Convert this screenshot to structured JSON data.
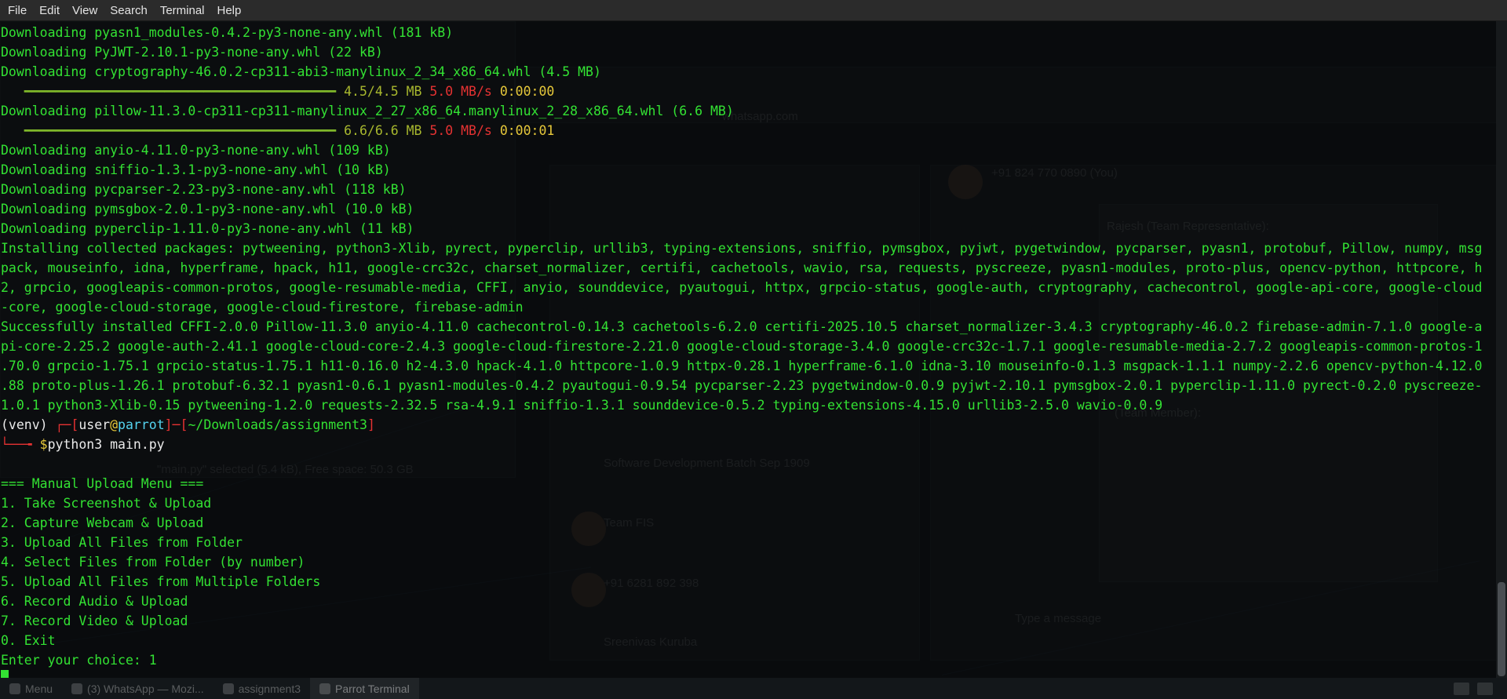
{
  "menubar": [
    "File",
    "Edit",
    "View",
    "Search",
    "Terminal",
    "Help"
  ],
  "colors": {
    "text": "#33e233",
    "progress": "#a8b82e",
    "speed": "#e63232",
    "eta": "#e6c83a",
    "prompt_red": "#e63232",
    "host_cyan": "#55d4f0"
  },
  "terminal": {
    "downloads_top": [
      "Downloading pyasn1_modules-0.4.2-py3-none-any.whl (181 kB)",
      "Downloading PyJWT-2.10.1-py3-none-any.whl (22 kB)",
      "Downloading cryptography-46.0.2-cp311-abi3-manylinux_2_34_x86_64.whl (4.5 MB)"
    ],
    "progress1": {
      "bar": "━━━━━━━━━━━━━━━━━━━━━━━━━━━━━━━━━━━━━━━━",
      "size": "4.5/4.5 MB",
      "speed": "5.0 MB/s",
      "eta": "0:00:00"
    },
    "download_pillow": "Downloading pillow-11.3.0-cp311-cp311-manylinux_2_27_x86_64.manylinux_2_28_x86_64.whl (6.6 MB)",
    "progress2": {
      "bar": "━━━━━━━━━━━━━━━━━━━━━━━━━━━━━━━━━━━━━━━━",
      "size": "6.6/6.6 MB",
      "speed": "5.0 MB/s",
      "eta": "0:00:01"
    },
    "downloads_bottom": [
      "Downloading anyio-4.11.0-py3-none-any.whl (109 kB)",
      "Downloading sniffio-1.3.1-py3-none-any.whl (10 kB)",
      "Downloading pycparser-2.23-py3-none-any.whl (118 kB)",
      "Downloading pymsgbox-2.0.1-py3-none-any.whl (10.0 kB)",
      "Downloading pyperclip-1.11.0-py3-none-any.whl (11 kB)"
    ],
    "installing": [
      "Installing collected packages: pytweening, python3-Xlib, pyrect, pyperclip, urllib3, typing-extensions, sniffio, pymsgbox, pyjwt, pygetwindow, pycparser, pyasn1, protobuf, Pillow, numpy, msg",
      "pack, mouseinfo, idna, hyperframe, hpack, h11, google-crc32c, charset_normalizer, certifi, cachetools, wavio, rsa, requests, pyscreeze, pyasn1-modules, proto-plus, opencv-python, httpcore, h",
      "2, grpcio, googleapis-common-protos, google-resumable-media, CFFI, anyio, sounddevice, pyautogui, httpx, grpcio-status, google-auth, cryptography, cachecontrol, google-api-core, google-cloud",
      "-core, google-cloud-storage, google-cloud-firestore, firebase-admin"
    ],
    "installed": [
      "Successfully installed CFFI-2.0.0 Pillow-11.3.0 anyio-4.11.0 cachecontrol-0.14.3 cachetools-6.2.0 certifi-2025.10.5 charset_normalizer-3.4.3 cryptography-46.0.2 firebase-admin-7.1.0 google-a",
      "pi-core-2.25.2 google-auth-2.41.1 google-cloud-core-2.4.3 google-cloud-firestore-2.21.0 google-cloud-storage-3.4.0 google-crc32c-1.7.1 google-resumable-media-2.7.2 googleapis-common-protos-1",
      ".70.0 grpcio-1.75.1 grpcio-status-1.75.1 h11-0.16.0 h2-4.3.0 hpack-4.1.0 httpcore-1.0.9 httpx-0.28.1 hyperframe-6.1.0 idna-3.10 mouseinfo-0.1.3 msgpack-1.1.1 numpy-2.2.6 opencv-python-4.12.0",
      ".88 proto-plus-1.26.1 protobuf-6.32.1 pyasn1-0.6.1 pyasn1-modules-0.4.2 pyautogui-0.9.54 pycparser-2.23 pygetwindow-0.0.9 pyjwt-2.10.1 pymsgbox-2.0.1 pyperclip-1.11.0 pyrect-0.2.0 pyscreeze-",
      "1.0.1 python3-Xlib-0.15 pytweening-1.2.0 requests-2.32.5 rsa-4.9.1 sniffio-1.3.1 sounddevice-0.5.2 typing-extensions-4.15.0 urllib3-2.5.0 wavio-0.0.9"
    ],
    "prompt": {
      "venv": "(venv) ",
      "corner_top": "┌─[",
      "user": "user",
      "at": "@",
      "host": "parrot",
      "mid": "]─[",
      "path": "~/Downloads/assignment3",
      "end": "]",
      "corner_bottom": "└──╼ ",
      "dollar": "$",
      "command": "python3 main.py"
    },
    "menu_lines": [
      "=== Manual Upload Menu ===",
      "1. Take Screenshot & Upload",
      "2. Capture Webcam & Upload",
      "3. Upload All Files from Folder",
      "4. Select Files from Folder (by number)",
      "5. Upload All Files from Multiple Folders",
      "6. Record Audio & Upload",
      "7. Record Video & Upload",
      "0. Exit"
    ],
    "choice_prompt": "Enter your choice: 1"
  },
  "taskbar": {
    "menu": "Menu",
    "whatsapp": "(3) WhatsApp — Mozi...",
    "folder": "assignment3",
    "terminal": "Parrot Terminal"
  }
}
